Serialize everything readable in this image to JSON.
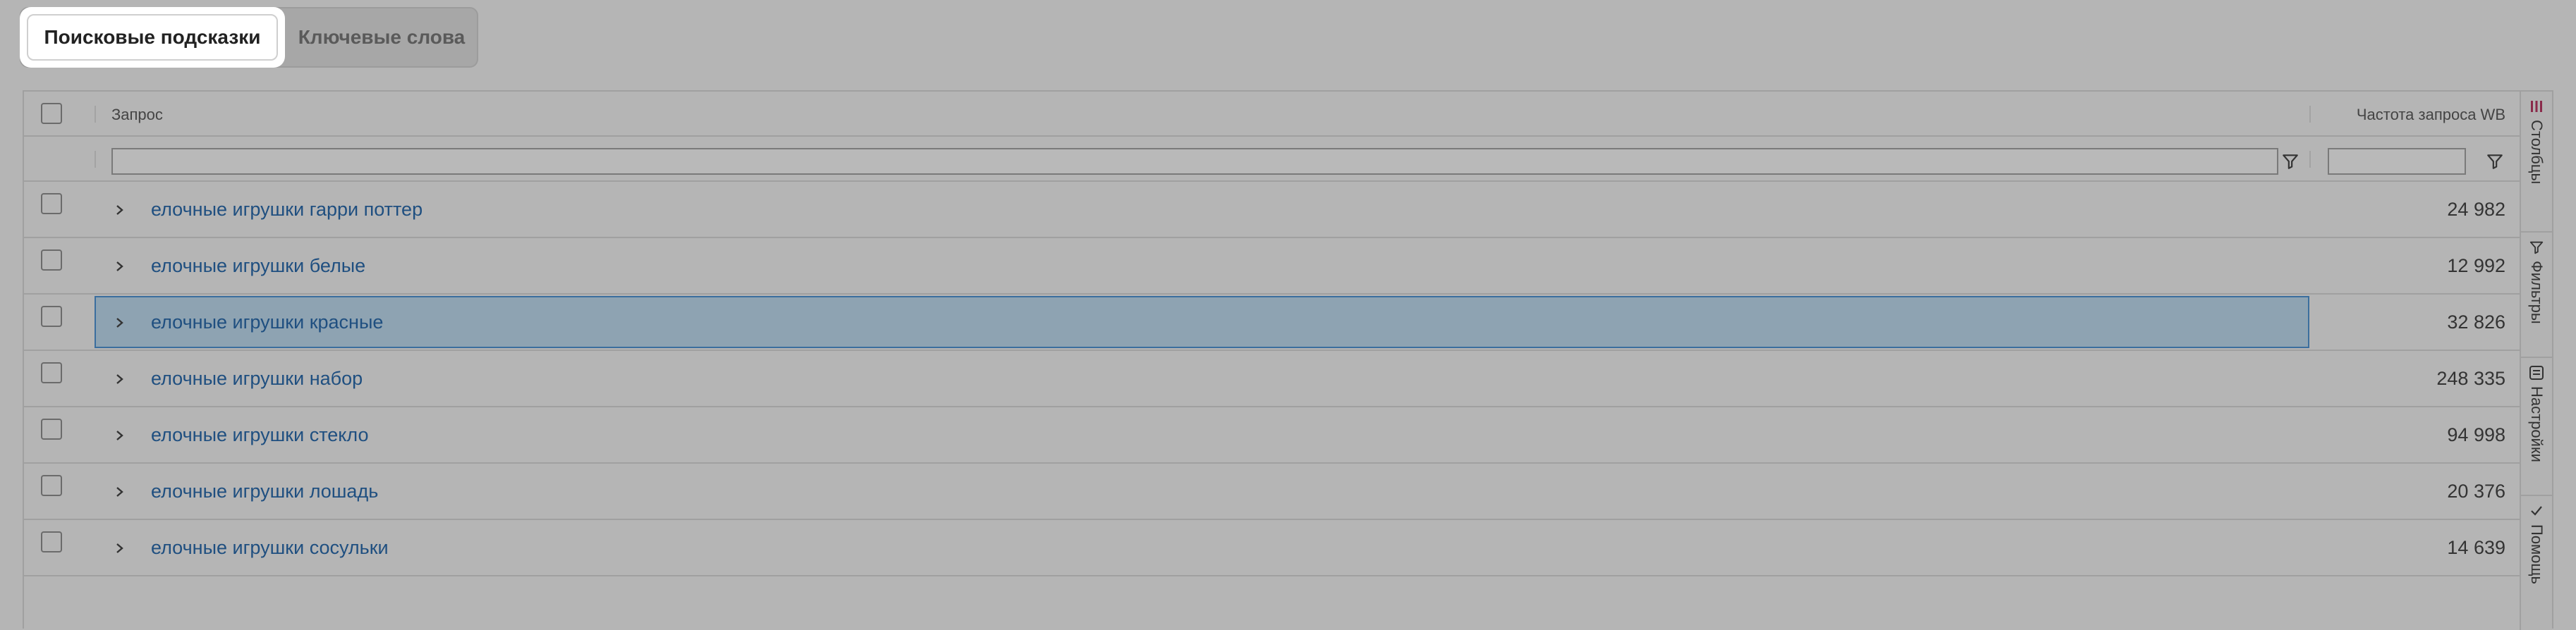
{
  "tabs": {
    "active": "Поисковые подсказки",
    "inactive": "Ключевые слова"
  },
  "grid": {
    "columns": {
      "query": "Запрос",
      "frequency": "Частота запроса WB"
    },
    "filters": {
      "query_value": "",
      "frequency_value": ""
    },
    "rows": [
      {
        "query": "елочные игрушки гарри поттер",
        "frequency": "24 982"
      },
      {
        "query": "елочные игрушки белые",
        "frequency": "12 992"
      },
      {
        "query": "елочные игрушки красные",
        "frequency": "32 826",
        "selected": true
      },
      {
        "query": "елочные игрушки набор",
        "frequency": "248 335"
      },
      {
        "query": "елочные игрушки стекло",
        "frequency": "94 998"
      },
      {
        "query": "елочные игрушки лошадь",
        "frequency": "20 376"
      },
      {
        "query": "елочные игрушки сосульки",
        "frequency": "14 639"
      }
    ]
  },
  "sidebar": {
    "items": [
      {
        "label": "Столбцы",
        "icon": "columns-icon"
      },
      {
        "label": "Фильтры",
        "icon": "filter-icon"
      },
      {
        "label": "Настройки",
        "icon": "settings-icon"
      },
      {
        "label": "Помощь",
        "icon": "check-icon"
      }
    ]
  },
  "colors": {
    "background": "#b5b5b5",
    "link": "#1f4f80",
    "selected_row": "#8ea3b2",
    "selected_border": "#3b6e9e"
  }
}
